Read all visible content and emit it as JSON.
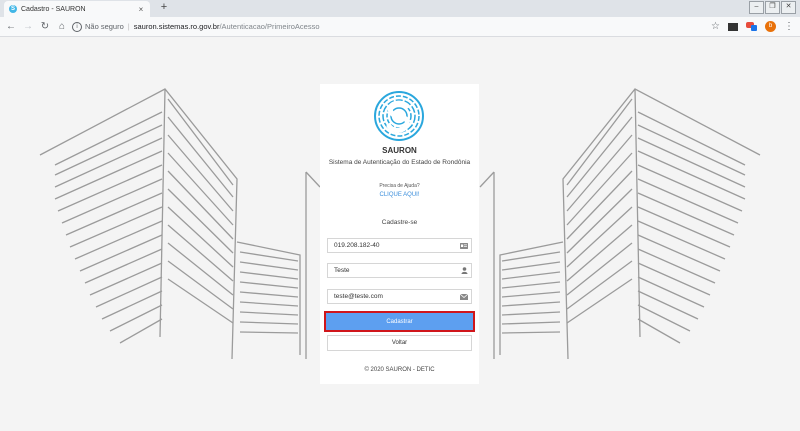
{
  "browser": {
    "tab_title": "Cadastro - SAURON",
    "tab_close": "×",
    "new_tab": "+",
    "insecure_label": "Não seguro",
    "url_host": "sauron.sistemas.ro.gov.br",
    "url_path": "/Autenticacao/PrimeiroAcesso",
    "profile_initial": "b"
  },
  "card": {
    "brand": "SAURON",
    "subtitle": "Sistema de Autenticação do Estado de Rondônia",
    "help_question": "Precisa de Ajuda?",
    "help_link": "CLIQUE AQUI!",
    "section_title": "Cadastre-se",
    "fields": {
      "cpf": {
        "value": "019.208.182-40",
        "icon": "id-card-icon"
      },
      "name": {
        "value": "Teste",
        "icon": "user-icon"
      },
      "email": {
        "value": "teste@teste.com",
        "icon": "envelope-icon"
      }
    },
    "submit_label": "Cadastrar",
    "back_label": "Voltar",
    "footer": "©  2020  SAURON -  DETIC"
  },
  "colors": {
    "primary_button": "#5d9ff0",
    "highlight_outline": "#d0161b",
    "link": "#3b8edb",
    "logo": "#2aa7dd"
  }
}
